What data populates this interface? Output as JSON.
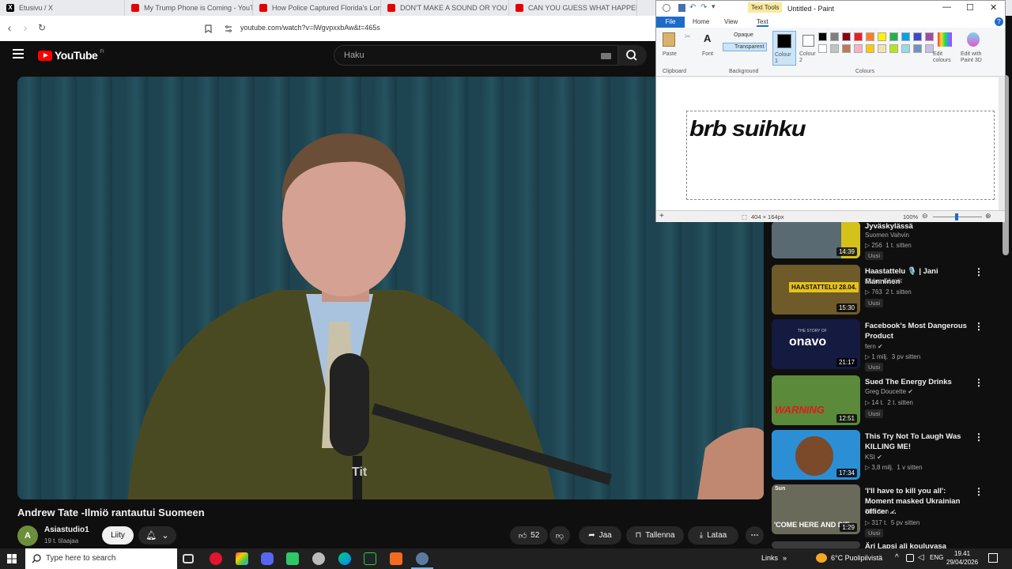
{
  "browser": {
    "tabs": [
      {
        "label": "Etusivu / X",
        "icon": "x-icon"
      },
      {
        "label": "My Trump Phone is Coming - YouTu",
        "icon": "youtube-icon"
      },
      {
        "label": "How Police Captured Florida's Long",
        "icon": "youtube-icon"
      },
      {
        "label": "DON'T MAKE A SOUND OR YOU DI",
        "icon": "youtube-icon"
      },
      {
        "label": "CAN YOU GUESS WHAT HAPPENS N",
        "icon": "youtube-icon"
      }
    ],
    "url": "youtube.com/watch?v=lWgvpxxbAw&t=465s"
  },
  "youtube": {
    "logo_text": "YouTube",
    "region": "FI",
    "search_placeholder": "Haku",
    "video": {
      "title": "Andrew Tate -Ilmiö rantautui Suomeen",
      "channel": "Asiastudio1",
      "channel_initials": "A",
      "subscribers": "19 t. tilaajaa",
      "join_label": "Liity",
      "likes": "52",
      "share_label": "Jaa",
      "save_label": "Tallenna",
      "download_label": "Lataa",
      "mic_label": "Tit"
    },
    "recommendations": [
      {
        "title": "Jyväskylässä",
        "channel": "Suomen Vahvin",
        "views": "256",
        "age": "1 t. sitten",
        "duration": "14:39",
        "badge": "Uusi",
        "verified": false
      },
      {
        "title": "Haastattelu 🎙️ | Jani Manninen",
        "channel": "Oulun Kärpät",
        "views": "763",
        "age": "2 t. sitten",
        "duration": "15:30",
        "badge": "Uusi",
        "thumb_text": "HAASTATTELU 28.04.",
        "verified": false
      },
      {
        "title": "Facebook's Most Dangerous Product",
        "channel": "fern",
        "views": "1 milj.",
        "age": "3 pv sitten",
        "duration": "21:17",
        "badge": "Uusi",
        "thumb_text": "onavo",
        "thumb_sub": "THE STORY OF",
        "verified": true
      },
      {
        "title": "Sued The Energy Drinks",
        "channel": "Greg Doucette",
        "views": "14 t.",
        "age": "2 t. sitten",
        "duration": "12:51",
        "badge": "Uusi",
        "thumb_text": "WARNING",
        "verified": true
      },
      {
        "title": "This Try Not To Laugh Was KILLING ME!",
        "channel": "KSI",
        "views": "3,8 milj.",
        "age": "1 v sitten",
        "duration": "17:34",
        "verified": true
      },
      {
        "title": "'I'll have to kill you all': Moment masked Ukrainian officer ...",
        "channel": "The Sun",
        "views": "317 t.",
        "age": "5 pv sitten",
        "duration": "1:29",
        "badge": "Uusi",
        "thumb_text": "'COME HERE AND DIE",
        "thumb_sub": "Sun",
        "verified": true
      },
      {
        "title": "Äri Lapsi ali kouluvasa",
        "channel": "",
        "views": "",
        "age": "",
        "duration": "",
        "verified": false
      }
    ]
  },
  "paint": {
    "context_tab": "Text Tools",
    "window_title": "Untitled - Paint",
    "tabs": [
      "File",
      "Home",
      "View",
      "Text"
    ],
    "ribbon": {
      "paste": "Paste",
      "font": "Font",
      "opaque": "Opaque",
      "transparent": "Transparent",
      "colour1": "Colour 1",
      "colour2": "Colour 2",
      "edit_colours": "Edit colours",
      "edit_paint3d": "Edit with Paint 3D",
      "groups": [
        "Clipboard",
        "Background",
        "Colours"
      ]
    },
    "palette": [
      "#000000",
      "#7f7f7f",
      "#880015",
      "#ed1c24",
      "#ff7f27",
      "#fff200",
      "#22b14c",
      "#00a2e8",
      "#3f48cc",
      "#a349a4",
      "#ffffff",
      "#c3c3c3",
      "#b97a57",
      "#ffaec9",
      "#ffc90e",
      "#efe4b0",
      "#b5e61d",
      "#99d9ea",
      "#7092be",
      "#c8bfe7"
    ],
    "canvas_text": "brb suihku",
    "status_size": "404 × 164px",
    "zoom": "100%"
  },
  "taskbar": {
    "search_placeholder": "Type here to search",
    "links": "Links",
    "weather": "6°C Puolipilvistä",
    "lang": "ENG",
    "time": "19.41",
    "date": "29/04/2026"
  }
}
